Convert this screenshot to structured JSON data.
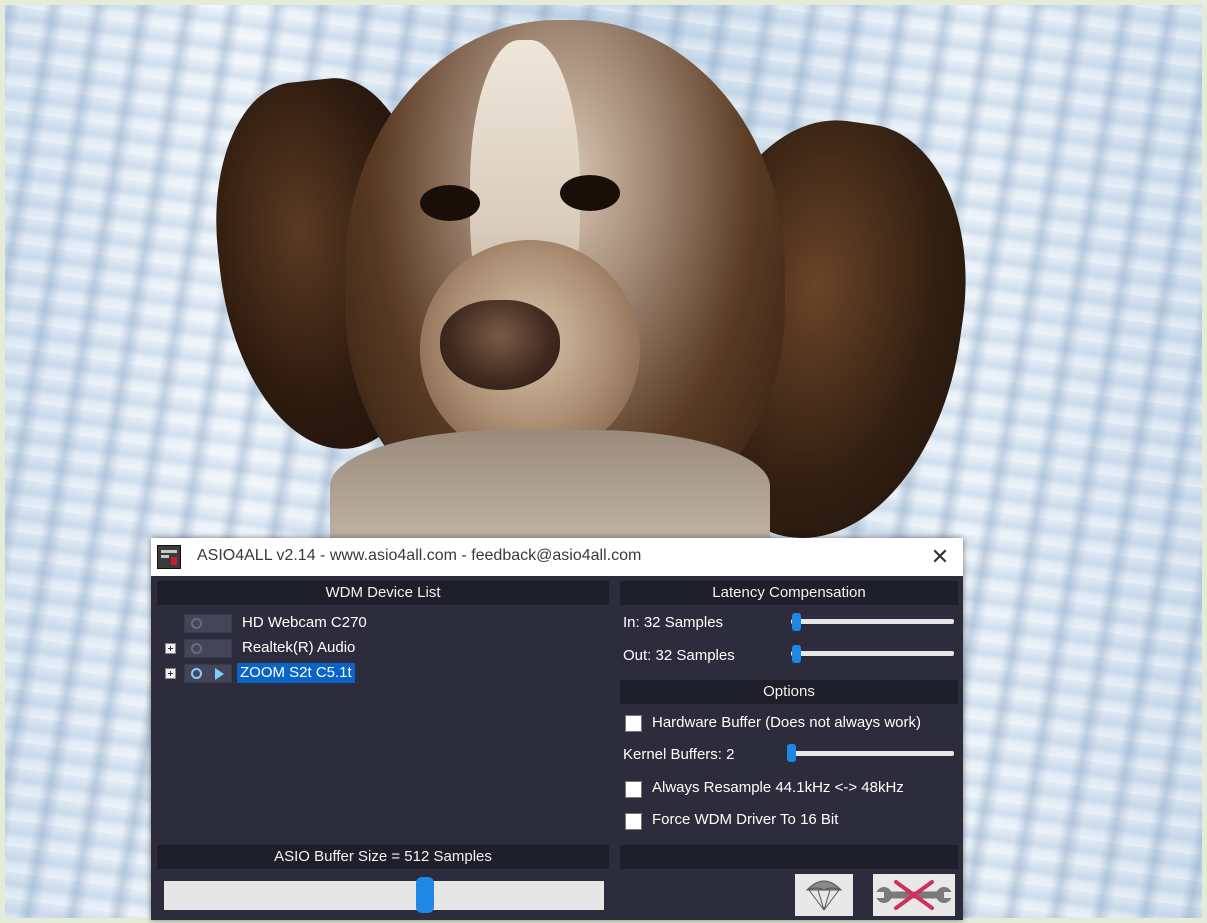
{
  "window": {
    "title": "ASIO4ALL v2.14 - www.asio4all.com - feedback@asio4all.com",
    "close_glyph": "✕"
  },
  "device_list": {
    "header": "WDM Device List",
    "devices": [
      {
        "name": "HD Webcam C270",
        "expandable": false,
        "active": false,
        "selected": false
      },
      {
        "name": "Realtek(R) Audio",
        "expandable": true,
        "active": false,
        "selected": false
      },
      {
        "name": "ZOOM S2t C5.1t",
        "expandable": true,
        "active": true,
        "selected": true
      }
    ]
  },
  "latency": {
    "header": "Latency Compensation",
    "in_label": "In:  32 Samples",
    "out_label": "Out: 32 Samples",
    "in_value": 32,
    "out_value": 32
  },
  "options": {
    "header": "Options",
    "hardware_buffer_label": "Hardware Buffer (Does not always work)",
    "hardware_buffer_checked": false,
    "kernel_buffers_label": "Kernel Buffers: 2",
    "kernel_buffers_value": 2,
    "always_resample_label": "Always Resample 44.1kHz <-> 48kHz",
    "always_resample_checked": false,
    "force_16bit_label": "Force WDM Driver To 16 Bit",
    "force_16bit_checked": false
  },
  "buffer": {
    "header": "ASIO Buffer Size = 512 Samples",
    "value": 512
  },
  "icons": {
    "app": "asio4all-app-icon",
    "close": "close-icon",
    "parachute": "parachute-icon",
    "wrench": "wrench-icon"
  },
  "colors": {
    "panel_bg": "#2c2c3c",
    "header_bg": "#1f1f2b",
    "accent": "#1e88e5",
    "selection": "#0a64c8"
  }
}
